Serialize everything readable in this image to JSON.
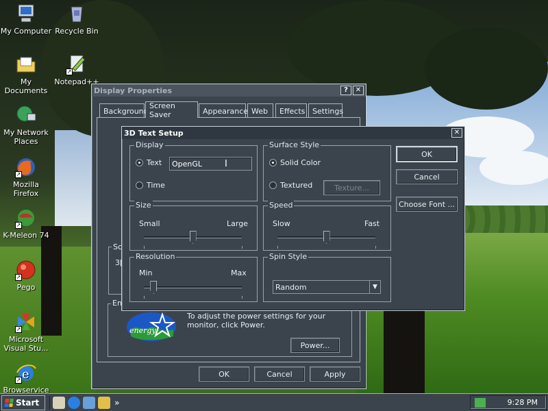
{
  "desktop": {
    "icons": [
      {
        "label": "My Computer",
        "shortcut": false
      },
      {
        "label": "Recycle Bin",
        "shortcut": false
      },
      {
        "label": "My Documents",
        "shortcut": false
      },
      {
        "label": "Notepad++",
        "shortcut": true
      },
      {
        "label": "My Network Places",
        "shortcut": false
      },
      {
        "label": "Mozilla Firefox",
        "shortcut": true
      },
      {
        "label": "K-Meleon 74",
        "shortcut": true
      },
      {
        "label": "Pego",
        "shortcut": true
      },
      {
        "label": "Microsoft Visual Stu...",
        "shortcut": true
      },
      {
        "label": "Browservice",
        "shortcut": true
      }
    ]
  },
  "display_properties": {
    "title": "Display Properties",
    "help_btn": "?",
    "close_btn": "✕",
    "tabs": [
      "Background",
      "Screen Saver",
      "Appearance",
      "Web",
      "Effects",
      "Settings"
    ],
    "selected_tab": "Screen Saver",
    "sc_fragment": "Sc",
    "digit_fragment": "3[",
    "energy_fragment": "En",
    "power_text": "To adjust the power settings for your monitor, click Power.",
    "power_button": "Power...",
    "ok": "OK",
    "cancel": "Cancel",
    "apply": "Apply",
    "energy_logo_text": "energy"
  },
  "text_setup": {
    "title": "3D Text Setup",
    "close_btn": "✕",
    "display": {
      "legend": "Display",
      "text_option": "Text",
      "time_option": "Time",
      "selected": "Text",
      "text_value": "OpenGL"
    },
    "surface": {
      "legend": "Surface Style",
      "solid_option": "Solid Color",
      "textured_option": "Textured",
      "selected": "Solid Color",
      "texture_button": "Texture..."
    },
    "size": {
      "legend": "Size",
      "min_label": "Small",
      "max_label": "Large",
      "value_fraction": 0.5
    },
    "speed": {
      "legend": "Speed",
      "min_label": "Slow",
      "max_label": "Fast",
      "value_fraction": 0.5
    },
    "resolution": {
      "legend": "Resolution",
      "min_label": "Min",
      "max_label": "Max",
      "value_fraction": 0.1
    },
    "spin": {
      "legend": "Spin Style",
      "value": "Random"
    },
    "ok": "OK",
    "cancel": "Cancel",
    "choose_font": "Choose Font ..."
  },
  "taskbar": {
    "start": "Start",
    "quicklaunch_more": "»",
    "clock": "9:28 PM"
  }
}
